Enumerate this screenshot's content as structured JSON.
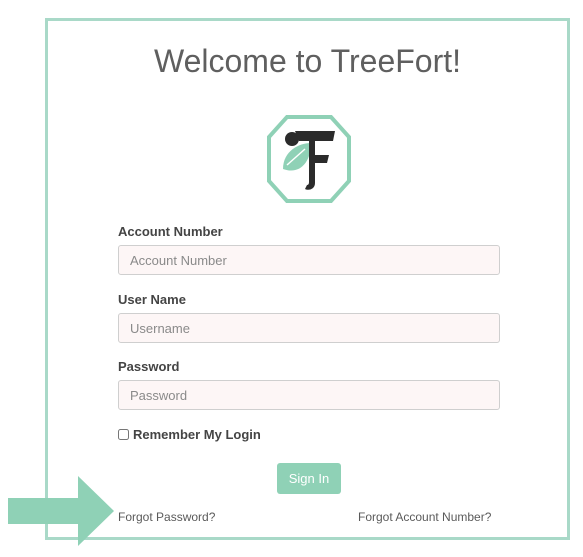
{
  "page": {
    "title": "Welcome to TreeFort!"
  },
  "logo": {
    "icon": "treefort-logo-icon",
    "colors": {
      "frame": "#8fd1b6",
      "leaf": "#8fd1b6",
      "letter": "#2b2b2b"
    }
  },
  "form": {
    "account_number": {
      "label": "Account Number",
      "placeholder": "Account Number",
      "value": ""
    },
    "user_name": {
      "label": "User Name",
      "placeholder": "Username",
      "value": ""
    },
    "password": {
      "label": "Password",
      "placeholder": "Password",
      "value": ""
    },
    "remember": {
      "label": "Remember My Login",
      "checked": false
    },
    "sign_in_label": "Sign In"
  },
  "links": {
    "forgot_password": "Forgot Password?",
    "forgot_account_number": "Forgot Account Number?"
  },
  "annotation": {
    "icon": "arrow-right-icon",
    "color": "#8fd1b6"
  },
  "colors": {
    "accent": "#8fd1b6",
    "card_border": "#a9d9c8",
    "input_bg": "#fdf6f6"
  }
}
